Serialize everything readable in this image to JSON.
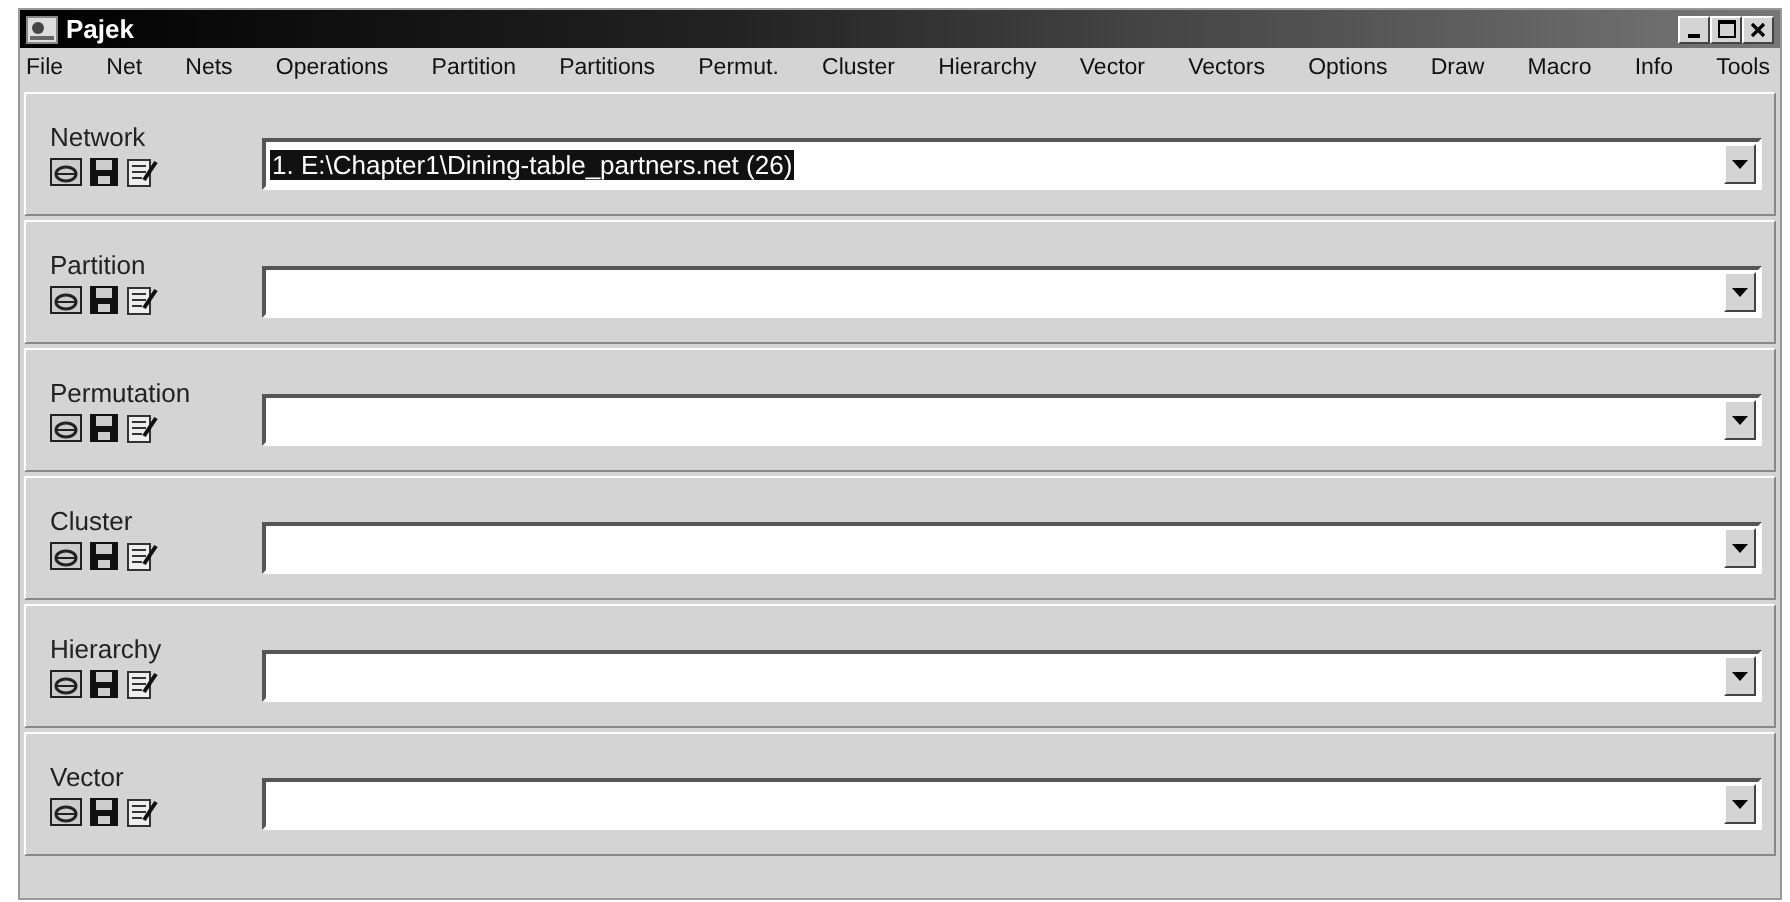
{
  "window": {
    "title": "Pajek"
  },
  "menu": [
    "File",
    "Net",
    "Nets",
    "Operations",
    "Partition",
    "Partitions",
    "Permut.",
    "Cluster",
    "Hierarchy",
    "Vector",
    "Vectors",
    "Options",
    "Draw",
    "Macro",
    "Info",
    "Tools"
  ],
  "panels": [
    {
      "label": "Network",
      "value": "1. E:\\Chapter1\\Dining-table_partners.net (26)",
      "value_selected": true
    },
    {
      "label": "Partition",
      "value_selected": false
    },
    {
      "label": "Permutation",
      "value_selected": false
    },
    {
      "label": "Cluster",
      "value_selected": false
    },
    {
      "label": "Hierarchy",
      "value_selected": false
    },
    {
      "label": "Vector",
      "value_selected": false
    }
  ]
}
